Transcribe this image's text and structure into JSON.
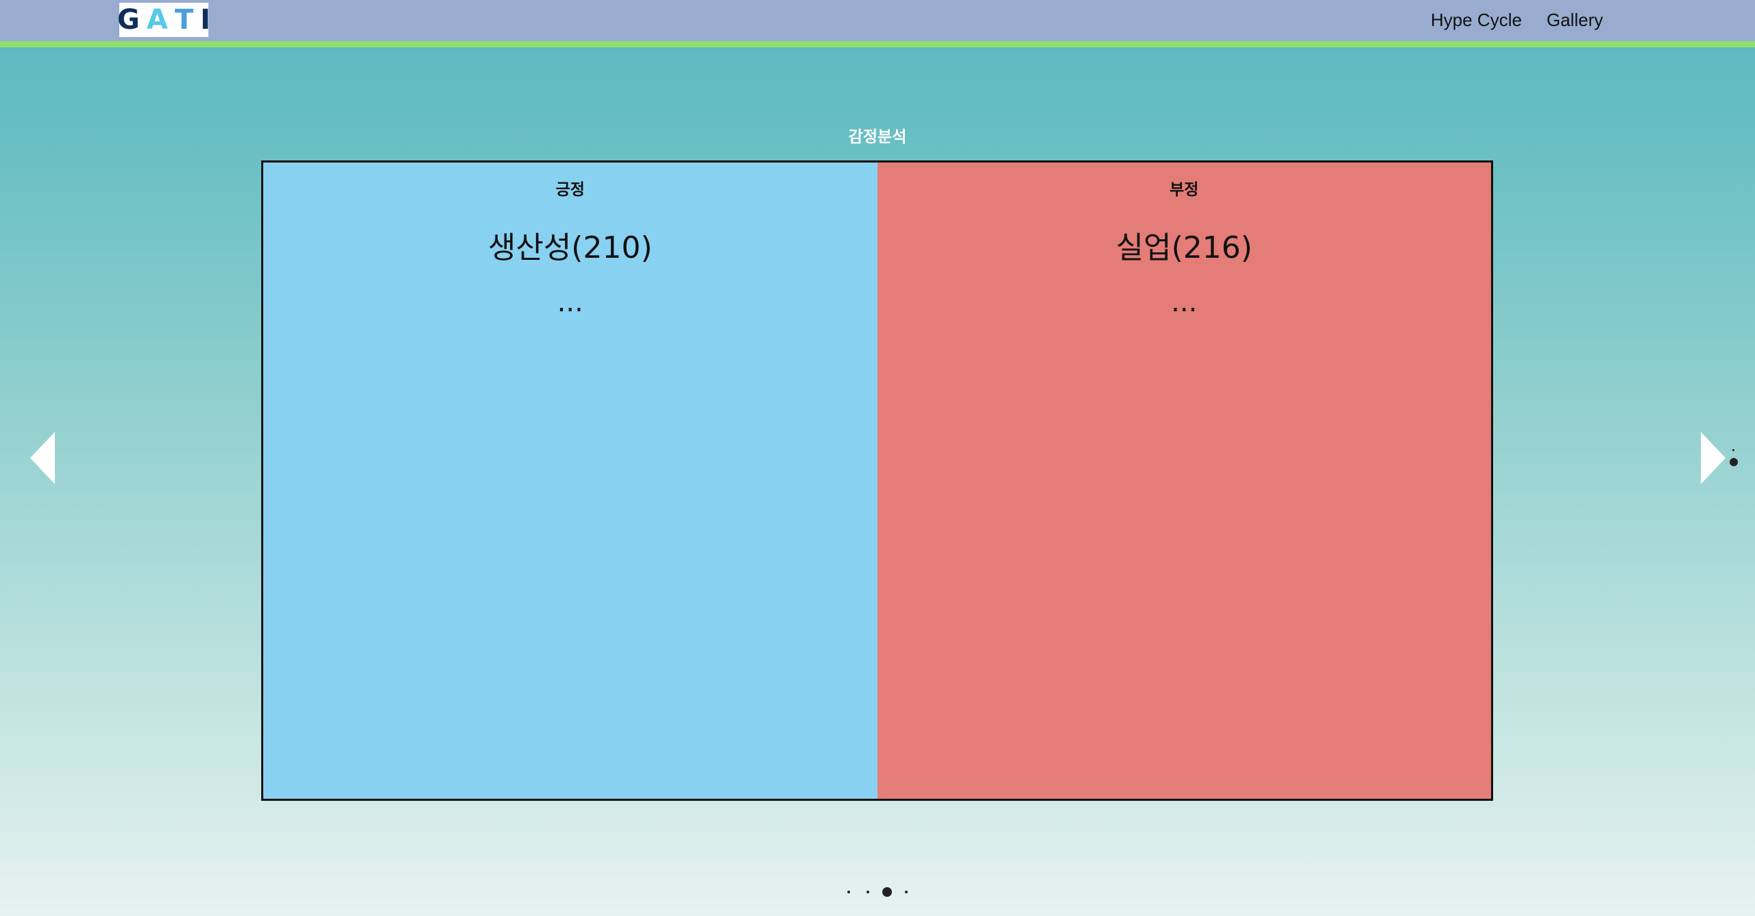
{
  "header": {
    "logo_letters": [
      "G",
      "A",
      "T",
      "I"
    ],
    "logo_colors": [
      "#0e2f5a",
      "#56c8e8",
      "#4aa0d8",
      "#0e2f5a"
    ],
    "nav": [
      "Hype Cycle",
      "Gallery"
    ]
  },
  "section": {
    "title": "감정분석"
  },
  "sentiment": {
    "positive": {
      "label": "긍정",
      "top_keyword": "생산성(210)",
      "more": "...",
      "color": "#89d1f1"
    },
    "negative": {
      "label": "부정",
      "top_keyword": "실업(216)",
      "more": "...",
      "color": "#e47d77"
    }
  },
  "carousel": {
    "page_count": 4,
    "active_page": 3,
    "side_indicator_count": 2,
    "side_indicator_active": 2
  }
}
